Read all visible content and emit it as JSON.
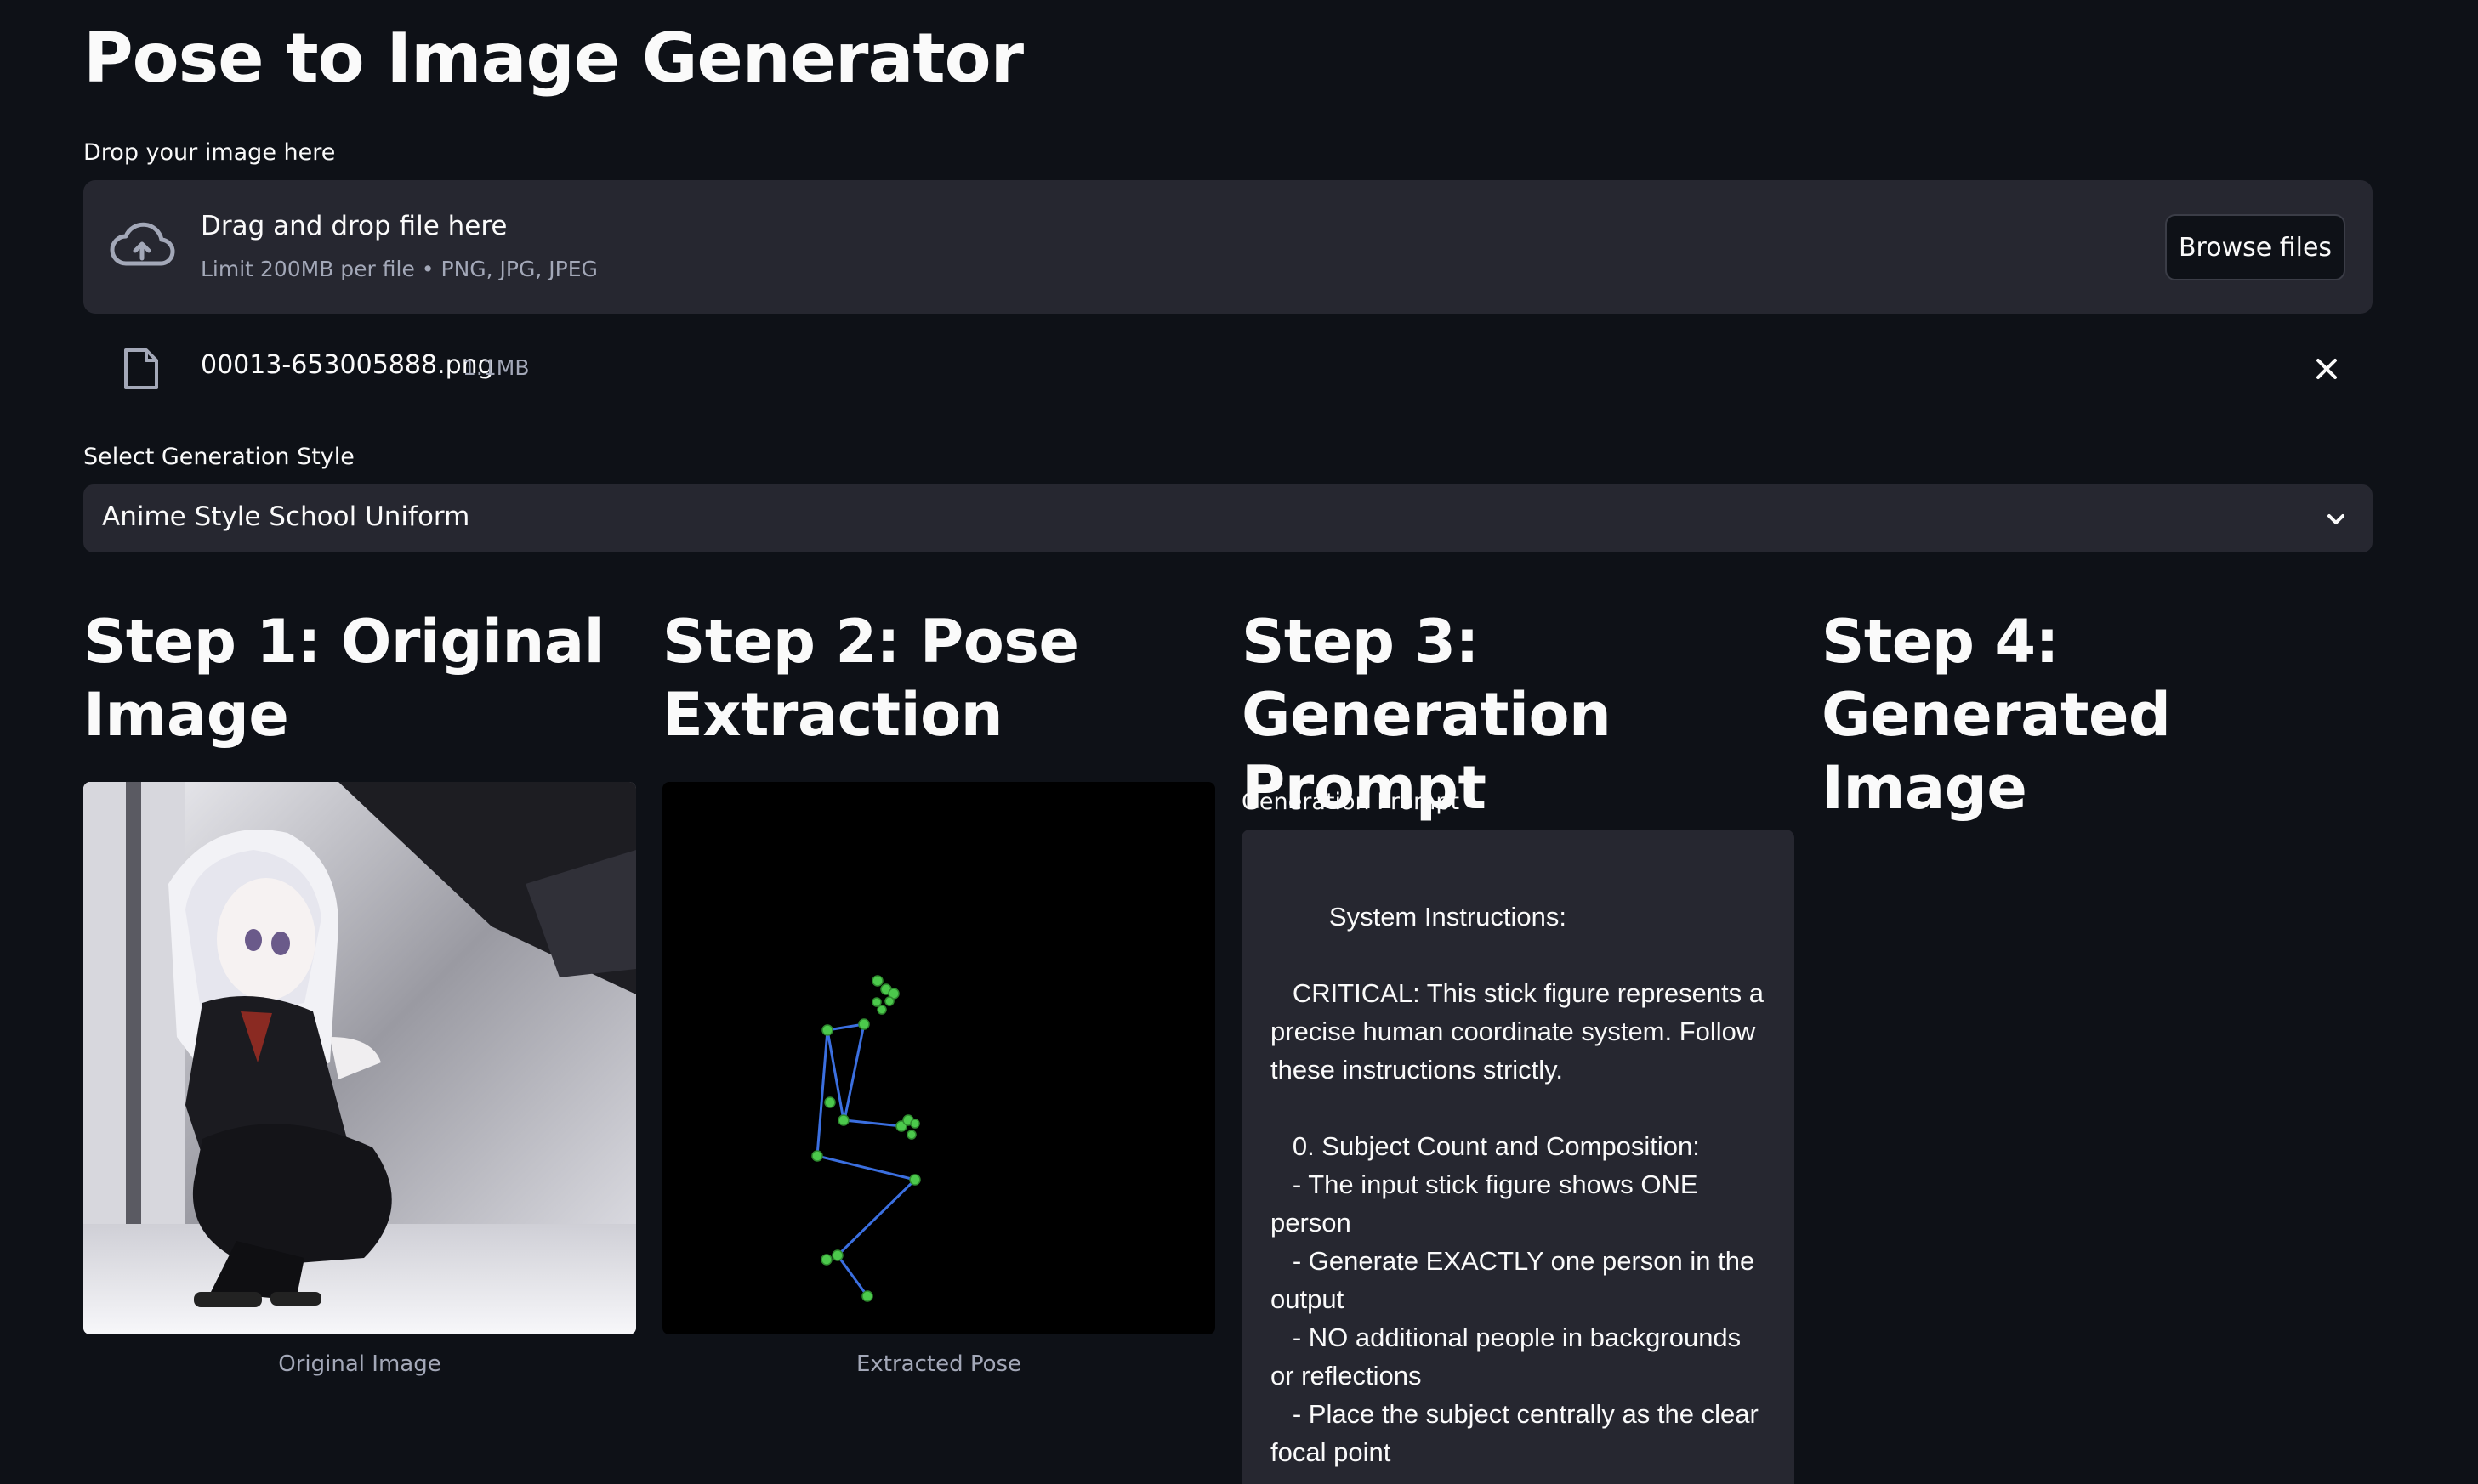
{
  "app": {
    "title": "Pose to Image Generator"
  },
  "uploader": {
    "label": "Drop your image here",
    "drag_text": "Drag and drop file here",
    "limit_text": "Limit 200MB per file • PNG, JPG, JPEG",
    "browse_label": "Browse files",
    "icon": "cloud-upload-icon"
  },
  "uploaded_file": {
    "name": "00013-653005888.png",
    "size": "1.1MB",
    "icon": "file-icon"
  },
  "style_select": {
    "label": "Select Generation Style",
    "selected": "Anime Style School Uniform"
  },
  "steps": [
    {
      "title": "Step 1: Original Image",
      "caption": "Original Image"
    },
    {
      "title": "Step 2: Pose Extraction",
      "caption": "Extracted Pose"
    },
    {
      "title": "Step 3: Generation Prompt"
    },
    {
      "title": "Step 4: Generated Image"
    }
  ],
  "prompt": {
    "label": "Generation Prompt",
    "text": "        System Instructions:\n\n   CRITICAL: This stick figure represents a precise human coordinate system. Follow these instructions strictly.\n\n   0. Subject Count and Composition:\n   - The input stick figure shows ONE person\n   - Generate EXACTLY one person in the output\n   - NO additional people in backgrounds or reflections\n   - Place the subject centrally as the clear focal point"
  },
  "colors": {
    "background": "#0e1117",
    "surface": "#262730",
    "text": "#fafafa",
    "muted": "#a3a8b8",
    "pose_line": "#3b6fe0",
    "pose_joint": "#4cc94c"
  }
}
